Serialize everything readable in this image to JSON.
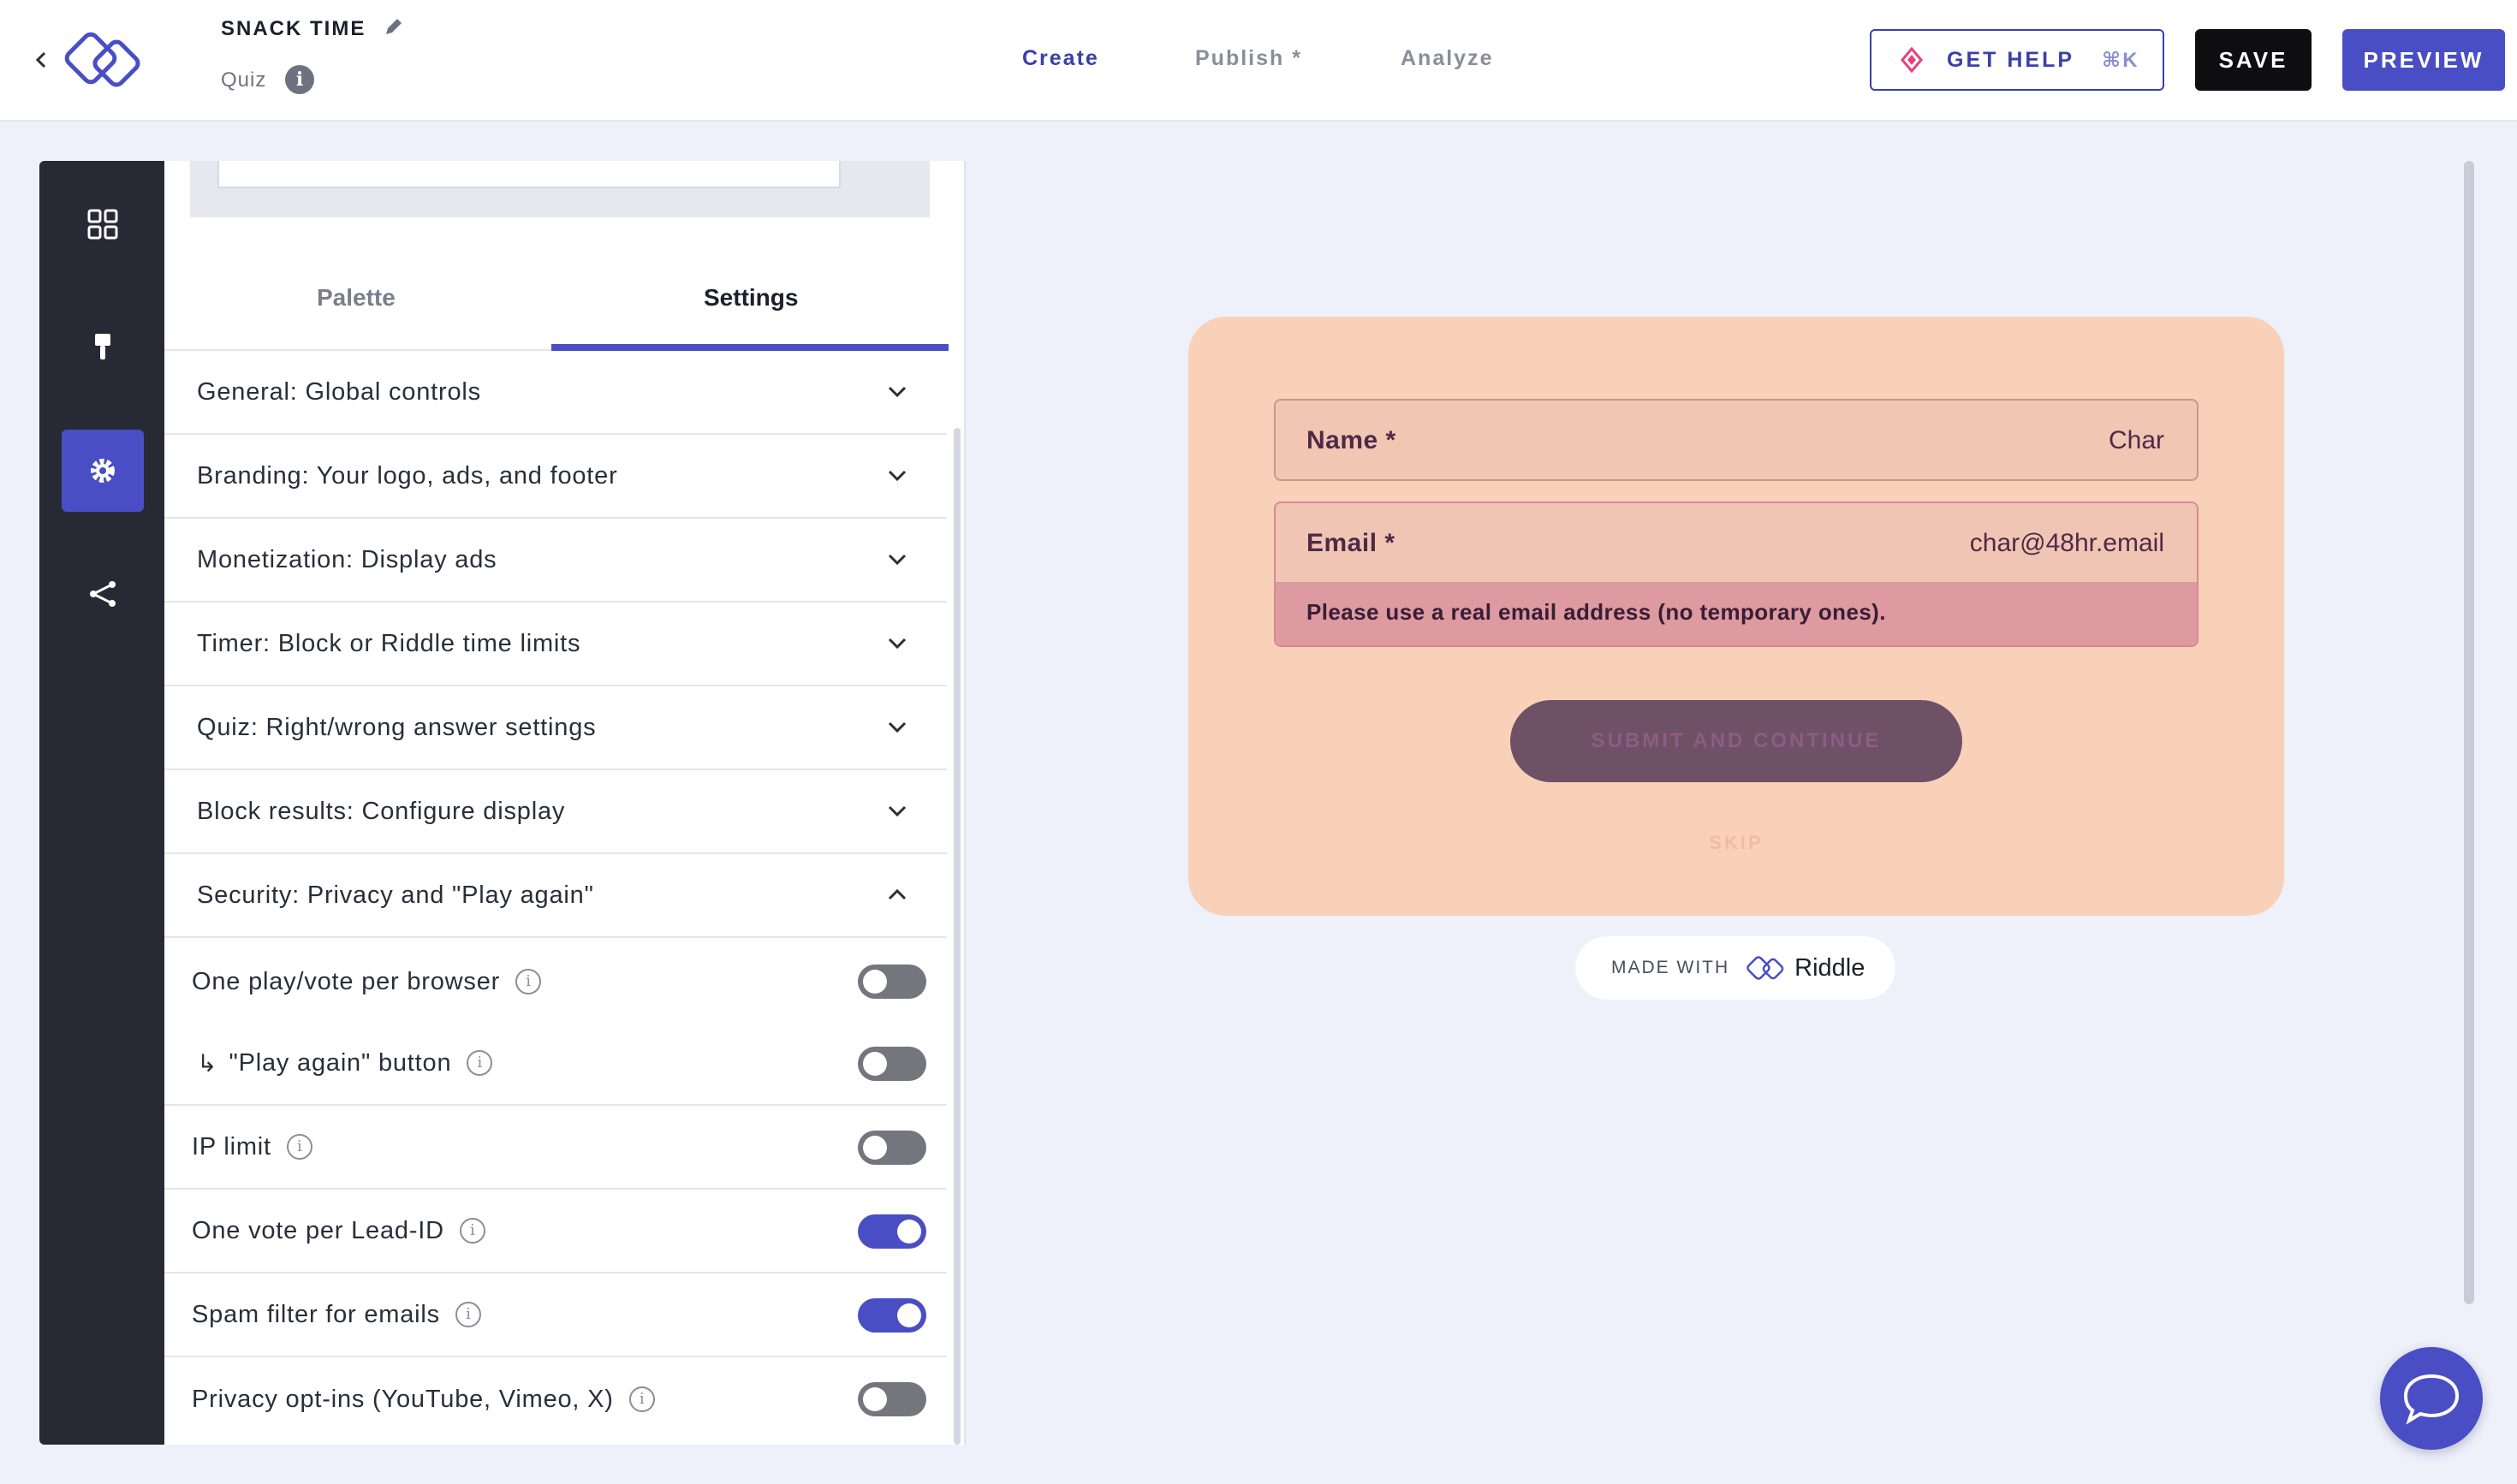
{
  "header": {
    "project_title": "SNACK TIME",
    "project_type": "Quiz",
    "nav_tabs": [
      {
        "label": "Create"
      },
      {
        "label": "Publish *"
      },
      {
        "label": "Analyze"
      }
    ],
    "help_label": "GET HELP",
    "help_shortcut": "⌘K",
    "save_label": "SAVE",
    "preview_label": "PREVIEW"
  },
  "panel": {
    "tabs": [
      {
        "label": "Palette"
      },
      {
        "label": "Settings"
      }
    ],
    "accordion": [
      {
        "label": "General: Global controls"
      },
      {
        "label": "Branding: Your logo, ads, and footer"
      },
      {
        "label": "Monetization: Display ads"
      },
      {
        "label": "Timer: Block or Riddle time limits"
      },
      {
        "label": "Quiz: Right/wrong answer settings"
      },
      {
        "label": "Block results: Configure display"
      },
      {
        "label": "Security: Privacy and \"Play again\""
      }
    ],
    "security_options": [
      {
        "label": "One play/vote per browser",
        "enabled": false
      },
      {
        "label": "\"Play again\" button",
        "enabled": false
      },
      {
        "label": "IP limit",
        "enabled": false
      },
      {
        "label": "One vote per Lead-ID",
        "enabled": true
      },
      {
        "label": "Spam filter for emails",
        "enabled": true
      },
      {
        "label": "Privacy opt-ins (YouTube, Vimeo, X)",
        "enabled": false
      }
    ]
  },
  "form": {
    "name_label": "Name *",
    "name_value": "Char",
    "email_label": "Email *",
    "email_value": "char@48hr.email",
    "error_text": "Please use a real email address (no temporary ones).",
    "submit_label": "SUBMIT AND CONTINUE",
    "skip_label": "SKIP"
  },
  "footer_badge": {
    "made_with": "MADE WITH",
    "brand": "Riddle"
  },
  "colors": {
    "accent": "#4a4ec4",
    "rail": "#272a35",
    "card": "#f8d1b8",
    "error": "#dd9aa0"
  }
}
